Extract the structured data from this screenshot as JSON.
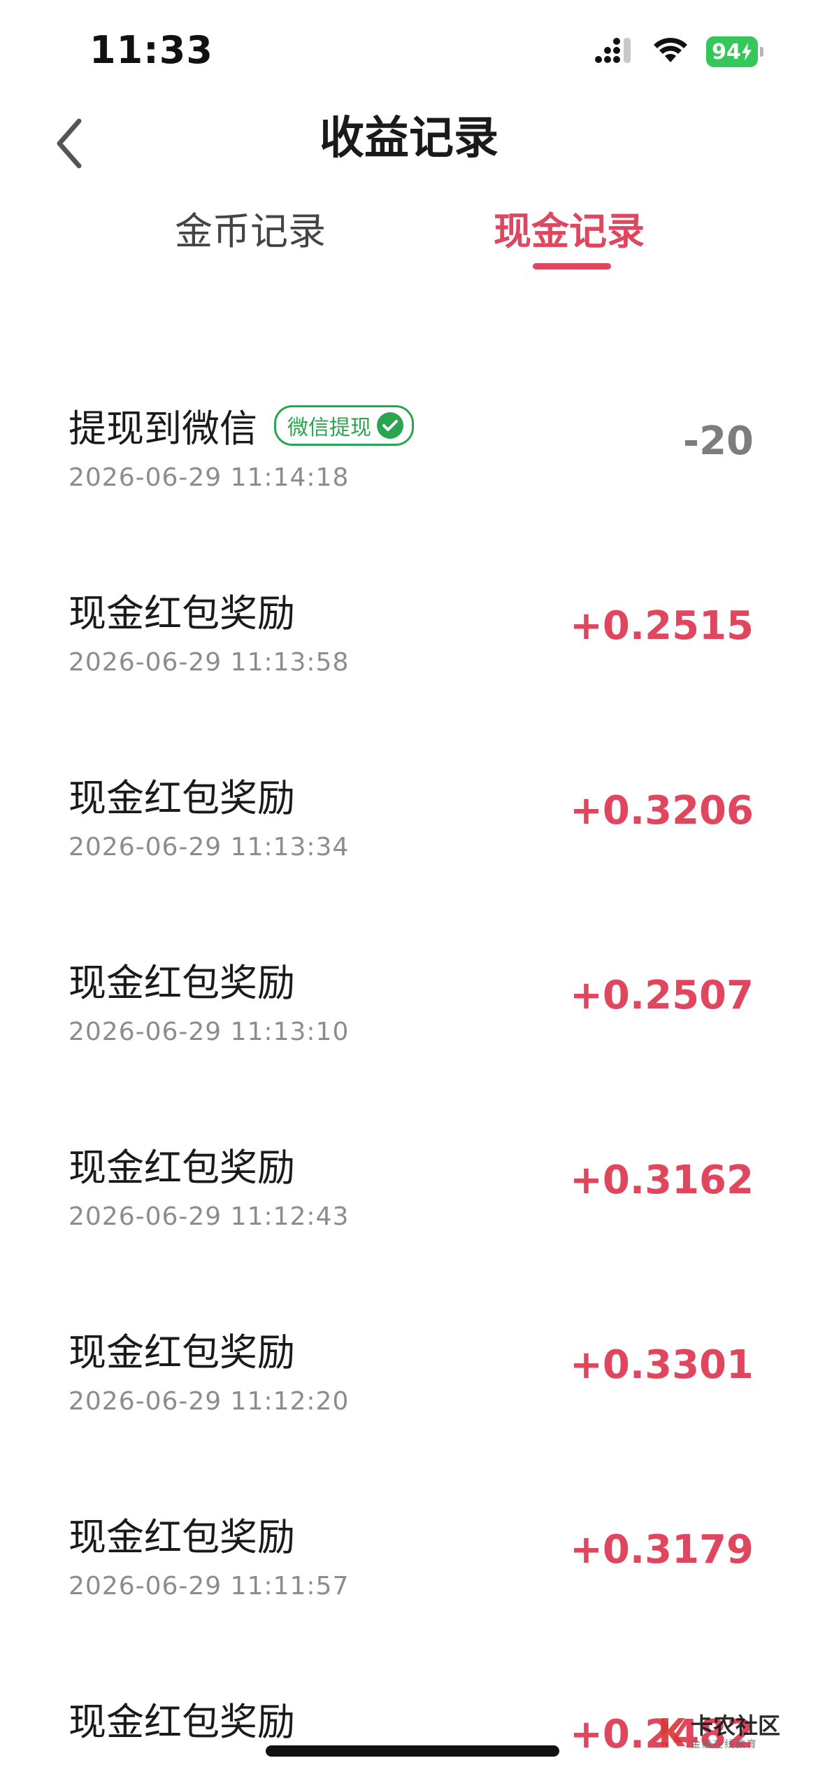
{
  "status_bar": {
    "time": "11:33",
    "battery": "94",
    "icons": [
      "cellular-signal-icon",
      "wifi-icon",
      "battery-charging-icon"
    ]
  },
  "header": {
    "title": "收益记录",
    "back_icon": "chevron-left-icon"
  },
  "tabs": [
    {
      "label": "金币记录",
      "active": false
    },
    {
      "label": "现金记录",
      "active": true
    }
  ],
  "records": [
    {
      "title": "提现到微信",
      "badge": "微信提现",
      "time": "2026-06-29 11:14:18",
      "amount": "-20"
    },
    {
      "title": "现金红包奖励",
      "time": "2026-06-29 11:13:58",
      "amount": "+0.2515"
    },
    {
      "title": "现金红包奖励",
      "time": "2026-06-29 11:13:34",
      "amount": "+0.3206"
    },
    {
      "title": "现金红包奖励",
      "time": "2026-06-29 11:13:10",
      "amount": "+0.2507"
    },
    {
      "title": "现金红包奖励",
      "time": "2026-06-29 11:12:43",
      "amount": "+0.3162"
    },
    {
      "title": "现金红包奖励",
      "time": "2026-06-29 11:12:20",
      "amount": "+0.3301"
    },
    {
      "title": "现金红包奖励",
      "time": "2026-06-29 11:11:57",
      "amount": "+0.3179"
    },
    {
      "title": "现金红包奖励",
      "time": "",
      "amount": "+0.2482"
    }
  ],
  "watermark": {
    "text": "卡农社区",
    "sub": "金融在线教育"
  },
  "colors": {
    "accent": "#e0465e",
    "badge_green": "#2aa54f",
    "battery_green": "#34c759",
    "muted_text": "#8c8c8c",
    "negative_amount": "#7d7d7d"
  }
}
